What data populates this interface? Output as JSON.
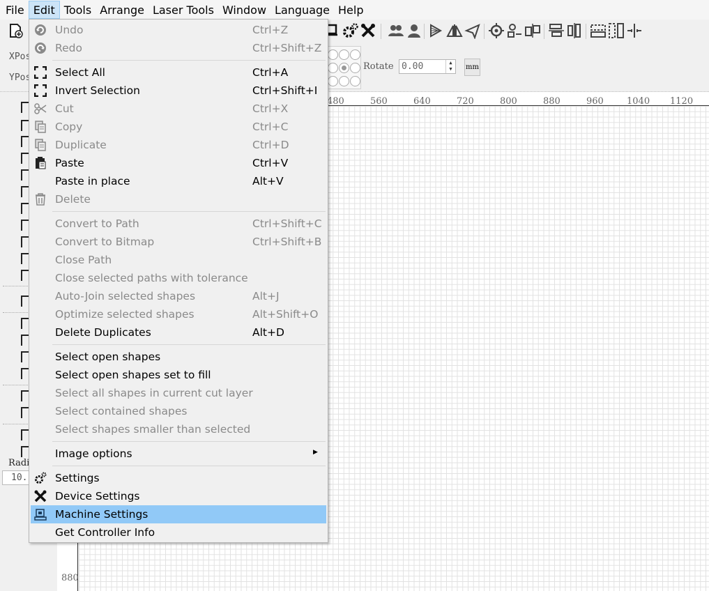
{
  "menubar": {
    "items": [
      "File",
      "Edit",
      "Tools",
      "Arrange",
      "Laser Tools",
      "Window",
      "Language",
      "Help"
    ]
  },
  "position_panel": {
    "xpos_label": "XPos",
    "ypos_label": "YPos",
    "rotate_label": "Rotate",
    "rotate_value": "0.00",
    "unit_button": "mm"
  },
  "ruler": {
    "h_ticks": [
      "480",
      "560",
      "640",
      "720",
      "800",
      "880",
      "960",
      "1040",
      "1120"
    ],
    "v_ticks": [
      "880"
    ]
  },
  "left_panel": {
    "radius_label": "Radi",
    "radius_value": "10."
  },
  "edit_menu": {
    "items": [
      {
        "label": "Undo",
        "shortcut": "Ctrl+Z",
        "icon": "undo-icon",
        "enabled": false
      },
      {
        "label": "Redo",
        "shortcut": "Ctrl+Shift+Z",
        "icon": "redo-icon",
        "enabled": false
      },
      {
        "label": "Select All",
        "shortcut": "Ctrl+A",
        "icon": "select-all-icon",
        "enabled": true
      },
      {
        "label": "Invert Selection",
        "shortcut": "Ctrl+Shift+I",
        "icon": "invert-selection-icon",
        "enabled": true
      },
      {
        "label": "Cut",
        "shortcut": "Ctrl+X",
        "icon": "scissors-icon",
        "enabled": false
      },
      {
        "label": "Copy",
        "shortcut": "Ctrl+C",
        "icon": "copy-icon",
        "enabled": false
      },
      {
        "label": "Duplicate",
        "shortcut": "Ctrl+D",
        "icon": "duplicate-icon",
        "enabled": false
      },
      {
        "label": "Paste",
        "shortcut": "Ctrl+V",
        "icon": "clipboard-icon",
        "enabled": true
      },
      {
        "label": "Paste in place",
        "shortcut": "Alt+V",
        "enabled": true
      },
      {
        "label": "Delete",
        "shortcut": "",
        "icon": "trash-icon",
        "enabled": false
      },
      {
        "label": "Convert to Path",
        "shortcut": "Ctrl+Shift+C",
        "enabled": false
      },
      {
        "label": "Convert to Bitmap",
        "shortcut": "Ctrl+Shift+B",
        "enabled": false
      },
      {
        "label": "Close Path",
        "shortcut": "",
        "enabled": false
      },
      {
        "label": "Close selected paths with tolerance",
        "shortcut": "",
        "enabled": false
      },
      {
        "label": "Auto-Join selected shapes",
        "shortcut": "Alt+J",
        "enabled": false
      },
      {
        "label": "Optimize selected shapes",
        "shortcut": "Alt+Shift+O",
        "enabled": false
      },
      {
        "label": "Delete Duplicates",
        "shortcut": "Alt+D",
        "enabled": true
      },
      {
        "label": "Select open shapes",
        "shortcut": "",
        "enabled": true
      },
      {
        "label": "Select open shapes set to fill",
        "shortcut": "",
        "enabled": true
      },
      {
        "label": "Select all shapes in current cut layer",
        "shortcut": "",
        "enabled": false
      },
      {
        "label": "Select contained shapes",
        "shortcut": "",
        "enabled": false
      },
      {
        "label": "Select shapes smaller than selected",
        "shortcut": "",
        "enabled": false
      },
      {
        "label": "Image options",
        "shortcut": "",
        "enabled": true,
        "submenu": true
      },
      {
        "label": "Settings",
        "shortcut": "",
        "icon": "gears-icon",
        "enabled": true
      },
      {
        "label": "Device Settings",
        "shortcut": "",
        "icon": "wrench-icon",
        "enabled": true
      },
      {
        "label": "Machine Settings",
        "shortcut": "",
        "icon": "machine-icon",
        "enabled": true,
        "highlighted": true
      },
      {
        "label": "Get Controller Info",
        "shortcut": "",
        "enabled": true
      }
    ]
  },
  "colors": {
    "highlight": "#91c9f7",
    "menubar_active": "#cce4f7",
    "disabled_text": "#8a8a8a",
    "grid_line": "#e2e2e2"
  }
}
